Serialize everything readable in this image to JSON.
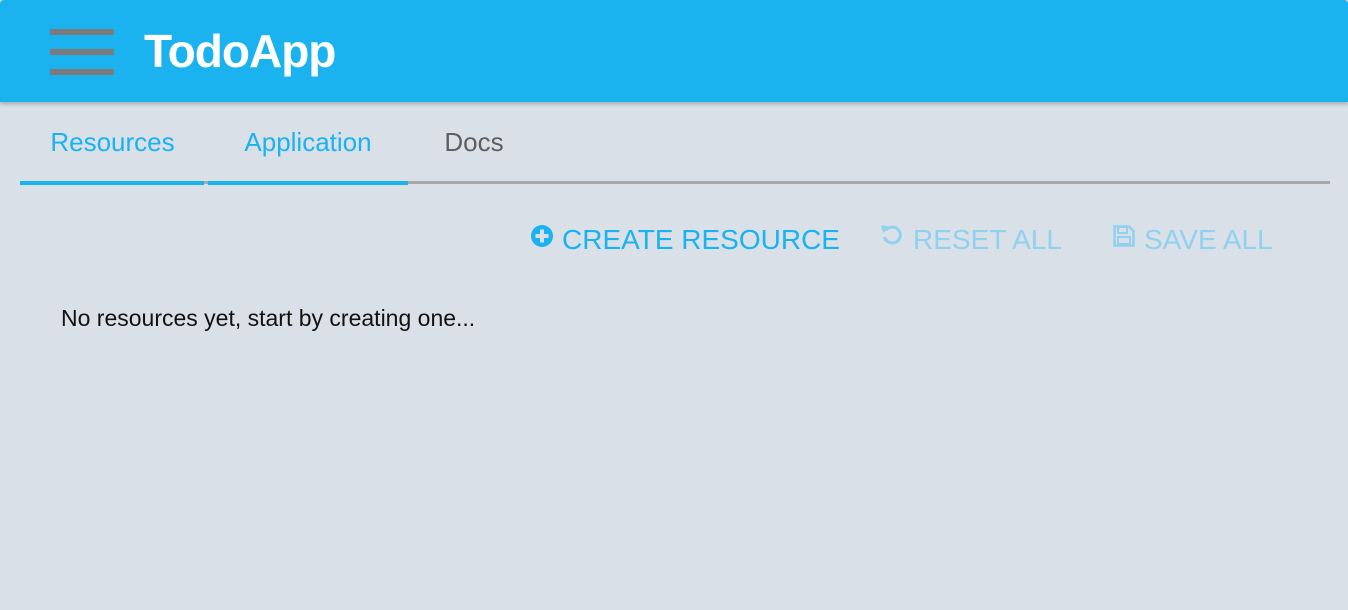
{
  "app": {
    "title": "TodoApp",
    "header_color": "#1ab3ef"
  },
  "menu": {
    "icon": "hamburger-menu-icon"
  },
  "tabs": [
    {
      "label": "Resources",
      "active": true
    },
    {
      "label": "Application",
      "active": true
    },
    {
      "label": "Docs",
      "active": false
    }
  ],
  "actions": {
    "create": {
      "label": "CREATE RESOURCE",
      "icon": "plus-circle-icon",
      "enabled": true
    },
    "reset": {
      "label": "RESET ALL",
      "icon": "undo-icon",
      "enabled": false
    },
    "save": {
      "label": "SAVE ALL",
      "icon": "floppy-disk-icon",
      "enabled": false
    }
  },
  "content": {
    "empty_message": "No resources yet, start by creating one..."
  },
  "colors": {
    "accent": "#1ab3ef",
    "disabled_accent": "#8fd1ee",
    "background": "#d9e0e8",
    "inactive_tab": "#5f5f5f"
  }
}
